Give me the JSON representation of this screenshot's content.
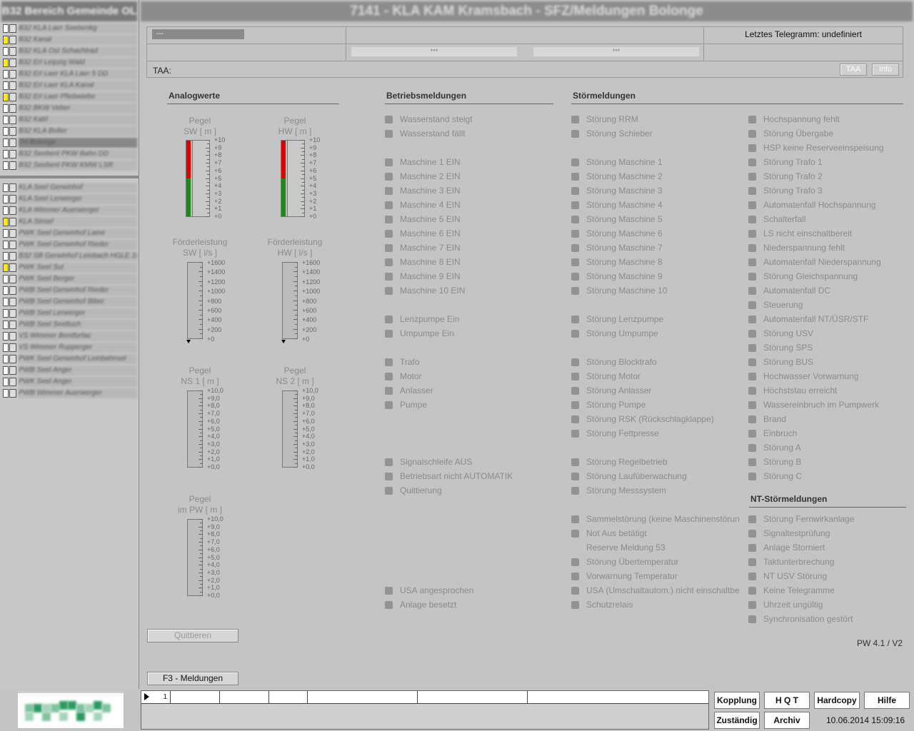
{
  "title": "7141 - KLA KAM Kramsbach - SFZ/Meldungen Bolonge",
  "sidebar": {
    "title": "B32 Bereich Gemeinde OL",
    "group1": [
      {
        "text": "B32 KLA Laer Seebenkg",
        "yellow": false
      },
      {
        "text": "B32 Kanal",
        "yellow": true
      },
      {
        "text": "B32 KLA Ost Schachtrad",
        "yellow": false
      },
      {
        "text": "B32 Erl Leipzig Wald",
        "yellow": true
      },
      {
        "text": "B32 Erl Laer KLA Laer 5 DD",
        "yellow": false
      },
      {
        "text": "B32 Erl Laer KLA Kanal",
        "yellow": false
      },
      {
        "text": "B32 Erl Laer Pfiebwiebe",
        "yellow": true
      },
      {
        "text": "B32 BKW Veber",
        "yellow": false
      },
      {
        "text": "B32 Kabl",
        "yellow": false
      },
      {
        "text": "B32 KLA Bolter",
        "yellow": false
      },
      {
        "text": "7H Bolonge",
        "yellow": false,
        "selected": true
      },
      {
        "text": "B32 Seebenl PKW Bahn DD",
        "yellow": false
      },
      {
        "text": "B32 Seebenl PKW KMW LSR",
        "yellow": false
      }
    ],
    "group2": [
      {
        "text": "KLA Seel Gerwinhof",
        "yellow": false
      },
      {
        "text": "KLA Seel Lerwerger",
        "yellow": false
      },
      {
        "text": "KLA Wimmer Auerwerger",
        "yellow": false
      },
      {
        "text": "KLA Sinsel",
        "yellow": true
      },
      {
        "text": "PWK Seel Gerwinhof Laine",
        "yellow": false
      },
      {
        "text": "PWK Seel Gerwinhof Rieder",
        "yellow": false
      },
      {
        "text": "B32 SB Gerwinhof Leinbach HGLE 1020",
        "yellow": false
      },
      {
        "text": "PWK Seel Sul",
        "yellow": true
      },
      {
        "text": "PWK Seel Berger",
        "yellow": false
      },
      {
        "text": "PWB Seel Gerwinhof Rieder",
        "yellow": false
      },
      {
        "text": "PWB Seel Gerwinhof Biber",
        "yellow": false
      },
      {
        "text": "PWB Seel Lerwerger",
        "yellow": false
      },
      {
        "text": "PWB Seel Seeltuch",
        "yellow": false
      },
      {
        "text": "VS Wimmer Bentfurfac",
        "yellow": false
      },
      {
        "text": "VS Wimmer Rupperger",
        "yellow": false
      },
      {
        "text": "PWK Seel Gerwinhof Leinbahnsel",
        "yellow": false
      },
      {
        "text": "PWB Seel Anger",
        "yellow": false
      },
      {
        "text": "PWK Seel Anger",
        "yellow": false
      },
      {
        "text": "PWB Wimmer Auerwerger",
        "yellow": false
      }
    ]
  },
  "header": {
    "field_dash": "---",
    "last_telegram": "Letztes Telegramm: undefiniert",
    "stars1": "***",
    "stars2": "***",
    "taa_label": "TAA:",
    "taa_btn": "TAA",
    "info_btn": "Info"
  },
  "analog": {
    "title": "Analogwerte",
    "gauges": [
      {
        "l1": "Pegel",
        "l2": "SW [ m ]",
        "scale": [
          "+10",
          "+9",
          "+8",
          "+7",
          "+6",
          "+5",
          "+4",
          "+3",
          "+2",
          "+1",
          "+0"
        ]
      },
      {
        "l1": "Pegel",
        "l2": "HW [ m ]",
        "scale": [
          "+10",
          "+9",
          "+8",
          "+7",
          "+6",
          "+5",
          "+4",
          "+3",
          "+2",
          "+1",
          "+0"
        ]
      },
      {
        "l1": "Förderleistung",
        "l2": "SW [ l/s ]",
        "scale": [
          "+1600",
          "+1400",
          "+1200",
          "+1000",
          "+800",
          "+600",
          "+400",
          "+200",
          "+0"
        ]
      },
      {
        "l1": "Förderleistung",
        "l2": "HW [ l/s ]",
        "scale": [
          "+1600",
          "+1400",
          "+1200",
          "+1000",
          "+800",
          "+600",
          "+400",
          "+200",
          "+0"
        ]
      },
      {
        "l1": "Pegel",
        "l2": "NS 1 [ m ]",
        "scale": [
          "+10,0",
          "+9,0",
          "+8,0",
          "+7,0",
          "+6,0",
          "+5,0",
          "+4,0",
          "+3,0",
          "+2,0",
          "+1,0",
          "+0,0"
        ]
      },
      {
        "l1": "Pegel",
        "l2": "NS 2 [ m ]",
        "scale": [
          "+10,0",
          "+9,0",
          "+8,0",
          "+7,0",
          "+6,0",
          "+5,0",
          "+4,0",
          "+3,0",
          "+2,0",
          "+1,0",
          "+0,0"
        ]
      },
      {
        "l1": "Pegel",
        "l2": "im PW [ m ]",
        "scale": [
          "+10,0",
          "+9,0",
          "+8,0",
          "+7,0",
          "+6,0",
          "+5,0",
          "+4,0",
          "+3,0",
          "+2,0",
          "+1,0",
          "+0,0"
        ]
      }
    ],
    "pegel_sw_red_fraction": 0.5,
    "pegel_hw_red_fraction": 0.5
  },
  "betrieb": {
    "title": "Betriebsmeldungen",
    "items": [
      {
        "t": "Wasserstand steigt",
        "r": 0
      },
      {
        "t": "Wasserstand fällt",
        "r": 1
      },
      {
        "t": "Maschine 1 EIN",
        "r": 3
      },
      {
        "t": "Maschine 2 EIN",
        "r": 4
      },
      {
        "t": "Maschine 3 EIN",
        "r": 5
      },
      {
        "t": "Maschine 4 EIN",
        "r": 6
      },
      {
        "t": "Maschine 5 EIN",
        "r": 7
      },
      {
        "t": "Maschine 6 EIN",
        "r": 8
      },
      {
        "t": "Maschine 7 EIN",
        "r": 9
      },
      {
        "t": "Maschine 8 EIN",
        "r": 10
      },
      {
        "t": "Maschine 9 EIN",
        "r": 11
      },
      {
        "t": "Maschine 10 EIN",
        "r": 12
      },
      {
        "t": "Lenzpumpe Ein",
        "r": 14
      },
      {
        "t": "Umpumpe Ein",
        "r": 15
      },
      {
        "t": "Trafo",
        "r": 17
      },
      {
        "t": "Motor",
        "r": 18
      },
      {
        "t": "Anlasser",
        "r": 19
      },
      {
        "t": "Pumpe",
        "r": 20
      },
      {
        "t": "Signalschleife AUS",
        "r": 24
      },
      {
        "t": "Betriebsart nicht AUTOMATIK",
        "r": 25
      },
      {
        "t": "Quittierung",
        "r": 26
      },
      {
        "t": "USA angesprochen",
        "r": 33
      },
      {
        "t": "Anlage besetzt",
        "r": 34
      }
    ]
  },
  "stoer": {
    "title": "Störmeldungen",
    "col1": [
      {
        "t": "Störung RRM",
        "r": 0
      },
      {
        "t": "Störung Schieber",
        "r": 1
      },
      {
        "t": "Störung Maschine 1",
        "r": 3
      },
      {
        "t": "Störung Maschine 2",
        "r": 4
      },
      {
        "t": "Störung Maschine 3",
        "r": 5
      },
      {
        "t": "Störung Maschine 4",
        "r": 6
      },
      {
        "t": "Störung Maschine 5",
        "r": 7
      },
      {
        "t": "Störung Maschine 6",
        "r": 8
      },
      {
        "t": "Störung Maschine 7",
        "r": 9
      },
      {
        "t": "Störung Maschine 8",
        "r": 10
      },
      {
        "t": "Störung Maschine 9",
        "r": 11
      },
      {
        "t": "Störung Maschine 10",
        "r": 12
      },
      {
        "t": "Störung Lenzpumpe",
        "r": 14
      },
      {
        "t": "Störung Umpumpe",
        "r": 15
      },
      {
        "t": "Störung Blocktrafo",
        "r": 17
      },
      {
        "t": "Störung Motor",
        "r": 18
      },
      {
        "t": "Störung Anlasser",
        "r": 19
      },
      {
        "t": "Störung Pumpe",
        "r": 20
      },
      {
        "t": "Störung  RSK (Rückschlagklappe)",
        "r": 21
      },
      {
        "t": "Störung Fettpresse",
        "r": 22
      },
      {
        "t": "Störung Regelbetrieb",
        "r": 24
      },
      {
        "t": "Störung Laufüberwachung",
        "r": 25
      },
      {
        "t": "Störung Messsystem",
        "r": 26
      },
      {
        "t": "Sammelstörung (keine Maschinenstörung)",
        "r": 28
      },
      {
        "t": "Not Aus betätigt",
        "r": 29
      },
      {
        "t": "Reserve Meldung 53",
        "r": 30,
        "noSquare": true
      },
      {
        "t": "Störung Übertemperatur",
        "r": 31
      },
      {
        "t": "Vorwarnung Temperatur",
        "r": 32
      },
      {
        "t": "USA (Umschaltautom.) nicht einschaltbereit",
        "r": 33
      },
      {
        "t": "Schutzrelais",
        "r": 34
      }
    ],
    "col2": [
      {
        "t": "Hochspannung fehlt",
        "r": 0
      },
      {
        "t": "Störung Übergabe",
        "r": 1
      },
      {
        "t": "HSP keine Reserveeinspeisung",
        "r": 2
      },
      {
        "t": "Störung Trafo 1",
        "r": 3
      },
      {
        "t": "Störung Trafo 2",
        "r": 4
      },
      {
        "t": "Störung Trafo 3",
        "r": 5
      },
      {
        "t": "Automatenfall Hochspannung",
        "r": 6
      },
      {
        "t": "Schalterfall",
        "r": 7
      },
      {
        "t": "LS nicht einschaltbereit",
        "r": 8
      },
      {
        "t": "Niederspannung fehlt",
        "r": 9
      },
      {
        "t": "Automatenfall Niederspannung",
        "r": 10
      },
      {
        "t": "Störung Gleichspannung",
        "r": 11
      },
      {
        "t": "Automatenfall DC",
        "r": 12
      },
      {
        "t": "Steuerung",
        "r": 13
      },
      {
        "t": "Automatenfall NT/ÜSR/STF",
        "r": 14
      },
      {
        "t": "Störung USV",
        "r": 15
      },
      {
        "t": "Störung SPS",
        "r": 16
      },
      {
        "t": "Störung BUS",
        "r": 17
      },
      {
        "t": "Hochwasser Vorwarnung",
        "r": 18
      },
      {
        "t": "Höchststau erreicht",
        "r": 19
      },
      {
        "t": "Wassereinbruch im Pumpwerk",
        "r": 20
      },
      {
        "t": "Brand",
        "r": 21
      },
      {
        "t": "Einbruch",
        "r": 22
      },
      {
        "t": "Störung A",
        "r": 23
      },
      {
        "t": "Störung B",
        "r": 24
      },
      {
        "t": "Störung C",
        "r": 25
      }
    ]
  },
  "nt": {
    "title": "NT-Störmeldungen",
    "items": [
      {
        "t": "Störung Fernwirkanlage",
        "r": 28
      },
      {
        "t": "Signaltestprüfung",
        "r": 29
      },
      {
        "t": "Anlage Storniert",
        "r": 30
      },
      {
        "t": "Taktunterbrechung",
        "r": 31
      },
      {
        "t": "NT USV Störung",
        "r": 32
      },
      {
        "t": "Keine Telegramme",
        "r": 33
      },
      {
        "t": "Uhrzeit ungültig",
        "r": 34
      },
      {
        "t": "Synchronisation gestört",
        "r": 35
      }
    ]
  },
  "buttons": {
    "quittieren": "Quittieren",
    "f3": "F3 - Meldungen",
    "kopplung": "Kopplung",
    "hqt": "H Q T",
    "hardcopy": "Hardcopy",
    "hilfe": "Hilfe",
    "zustaendig": "Zuständig",
    "archiv": "Archiv"
  },
  "version": "PW 4.1 / V2",
  "datetime": "10.06.2014 15:09:16",
  "bottom_table": {
    "row_number": "1"
  },
  "colors": {
    "red": "#e00000",
    "green": "#1a8a1a",
    "yellow": "#f5f000",
    "square": "#939393"
  }
}
